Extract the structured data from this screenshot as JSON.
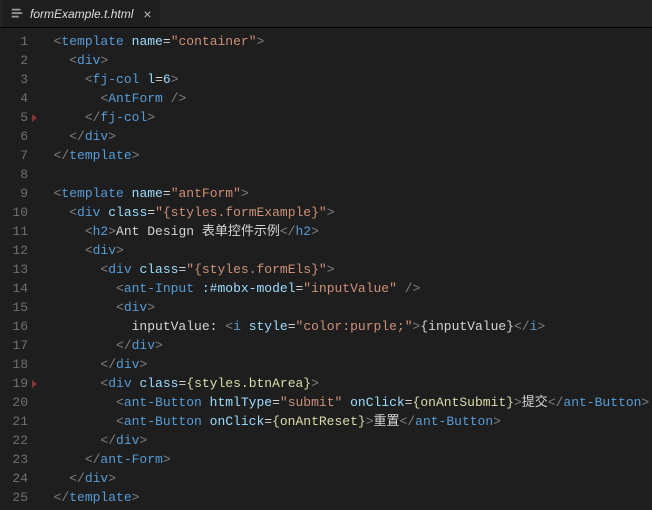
{
  "tab": {
    "filename": "formExample.t.html",
    "close_glyph": "×"
  },
  "lineNumbers": [
    "1",
    "2",
    "3",
    "4",
    "5",
    "6",
    "7",
    "8",
    "9",
    "10",
    "11",
    "12",
    "13",
    "14",
    "15",
    "16",
    "17",
    "18",
    "19",
    "20",
    "21",
    "22",
    "23",
    "24",
    "25"
  ],
  "code": {
    "rows": [
      {
        "indent": 1,
        "tokens": [
          {
            "c": "t-punc",
            "t": "<"
          },
          {
            "c": "t-tag",
            "t": "template"
          },
          {
            "c": "t-text",
            "t": " "
          },
          {
            "c": "t-attr",
            "t": "name"
          },
          {
            "c": "t-text",
            "t": "="
          },
          {
            "c": "t-str",
            "t": "\"container\""
          },
          {
            "c": "t-punc",
            "t": ">"
          }
        ]
      },
      {
        "indent": 2,
        "tokens": [
          {
            "c": "t-punc",
            "t": "<"
          },
          {
            "c": "t-tag",
            "t": "div"
          },
          {
            "c": "t-punc",
            "t": ">"
          }
        ]
      },
      {
        "indent": 3,
        "tokens": [
          {
            "c": "t-punc",
            "t": "<"
          },
          {
            "c": "t-tag",
            "t": "fj-col"
          },
          {
            "c": "t-text",
            "t": " "
          },
          {
            "c": "t-attr",
            "t": "l"
          },
          {
            "c": "t-text",
            "t": "="
          },
          {
            "c": "t-attr",
            "t": "6"
          },
          {
            "c": "t-punc",
            "t": ">"
          }
        ]
      },
      {
        "indent": 4,
        "tokens": [
          {
            "c": "t-punc",
            "t": "<"
          },
          {
            "c": "t-tag",
            "t": "AntForm"
          },
          {
            "c": "t-text",
            "t": " "
          },
          {
            "c": "t-punc",
            "t": "/>"
          }
        ]
      },
      {
        "indent": 3,
        "tokens": [
          {
            "c": "t-punc",
            "t": "</"
          },
          {
            "c": "t-tag",
            "t": "fj-col"
          },
          {
            "c": "t-punc",
            "t": ">"
          }
        ]
      },
      {
        "indent": 2,
        "tokens": [
          {
            "c": "t-punc",
            "t": "</"
          },
          {
            "c": "t-tag",
            "t": "div"
          },
          {
            "c": "t-punc",
            "t": ">"
          }
        ]
      },
      {
        "indent": 1,
        "tokens": [
          {
            "c": "t-punc",
            "t": "</"
          },
          {
            "c": "t-tag",
            "t": "template"
          },
          {
            "c": "t-punc",
            "t": ">"
          }
        ]
      },
      {
        "indent": 0,
        "tokens": []
      },
      {
        "indent": 1,
        "tokens": [
          {
            "c": "t-punc",
            "t": "<"
          },
          {
            "c": "t-tag",
            "t": "template"
          },
          {
            "c": "t-text",
            "t": " "
          },
          {
            "c": "t-attr",
            "t": "name"
          },
          {
            "c": "t-text",
            "t": "="
          },
          {
            "c": "t-str",
            "t": "\"antForm\""
          },
          {
            "c": "t-punc",
            "t": ">"
          }
        ]
      },
      {
        "indent": 2,
        "tokens": [
          {
            "c": "t-punc",
            "t": "<"
          },
          {
            "c": "t-tag",
            "t": "div"
          },
          {
            "c": "t-text",
            "t": " "
          },
          {
            "c": "t-attr",
            "t": "class"
          },
          {
            "c": "t-text",
            "t": "="
          },
          {
            "c": "t-str",
            "t": "\"{styles.formExample}\""
          },
          {
            "c": "t-punc",
            "t": ">"
          }
        ]
      },
      {
        "indent": 3,
        "tokens": [
          {
            "c": "t-punc",
            "t": "<"
          },
          {
            "c": "t-tag",
            "t": "h2"
          },
          {
            "c": "t-punc",
            "t": ">"
          },
          {
            "c": "t-text",
            "t": "Ant Design 表单控件示例"
          },
          {
            "c": "t-punc",
            "t": "</"
          },
          {
            "c": "t-tag",
            "t": "h2"
          },
          {
            "c": "t-punc",
            "t": ">"
          }
        ]
      },
      {
        "indent": 3,
        "tokens": [
          {
            "c": "t-punc",
            "t": "<"
          },
          {
            "c": "t-tag",
            "t": "div"
          },
          {
            "c": "t-punc",
            "t": ">"
          }
        ]
      },
      {
        "indent": 4,
        "tokens": [
          {
            "c": "t-punc",
            "t": "<"
          },
          {
            "c": "t-tag",
            "t": "div"
          },
          {
            "c": "t-text",
            "t": " "
          },
          {
            "c": "t-attr",
            "t": "class"
          },
          {
            "c": "t-text",
            "t": "="
          },
          {
            "c": "t-str",
            "t": "\"{styles.formEls}\""
          },
          {
            "c": "t-punc",
            "t": ">"
          }
        ]
      },
      {
        "indent": 5,
        "tokens": [
          {
            "c": "t-punc",
            "t": "<"
          },
          {
            "c": "t-tag",
            "t": "ant-Input"
          },
          {
            "c": "t-text",
            "t": " "
          },
          {
            "c": "t-attr",
            "t": ":#mobx-model"
          },
          {
            "c": "t-text",
            "t": "="
          },
          {
            "c": "t-str",
            "t": "\"inputValue\""
          },
          {
            "c": "t-text",
            "t": " "
          },
          {
            "c": "t-punc",
            "t": "/>"
          }
        ]
      },
      {
        "indent": 5,
        "tokens": [
          {
            "c": "t-punc",
            "t": "<"
          },
          {
            "c": "t-tag",
            "t": "div"
          },
          {
            "c": "t-punc",
            "t": ">"
          }
        ]
      },
      {
        "indent": 6,
        "tokens": [
          {
            "c": "t-text",
            "t": "inputValue: "
          },
          {
            "c": "t-punc",
            "t": "<"
          },
          {
            "c": "t-tag",
            "t": "i"
          },
          {
            "c": "t-text",
            "t": " "
          },
          {
            "c": "t-attr",
            "t": "style"
          },
          {
            "c": "t-text",
            "t": "="
          },
          {
            "c": "t-str",
            "t": "\"color:purple;\""
          },
          {
            "c": "t-punc",
            "t": ">"
          },
          {
            "c": "t-text",
            "t": "{inputValue}"
          },
          {
            "c": "t-punc",
            "t": "</"
          },
          {
            "c": "t-tag",
            "t": "i"
          },
          {
            "c": "t-punc",
            "t": ">"
          }
        ]
      },
      {
        "indent": 5,
        "tokens": [
          {
            "c": "t-punc",
            "t": "</"
          },
          {
            "c": "t-tag",
            "t": "div"
          },
          {
            "c": "t-punc",
            "t": ">"
          }
        ]
      },
      {
        "indent": 4,
        "tokens": [
          {
            "c": "t-punc",
            "t": "</"
          },
          {
            "c": "t-tag",
            "t": "div"
          },
          {
            "c": "t-punc",
            "t": ">"
          }
        ]
      },
      {
        "indent": 4,
        "tokens": [
          {
            "c": "t-punc",
            "t": "<"
          },
          {
            "c": "t-tag",
            "t": "div"
          },
          {
            "c": "t-text",
            "t": " "
          },
          {
            "c": "t-attr",
            "t": "class"
          },
          {
            "c": "t-text",
            "t": "="
          },
          {
            "c": "t-js",
            "t": "{styles.btnArea}"
          },
          {
            "c": "t-punc",
            "t": ">"
          }
        ]
      },
      {
        "indent": 5,
        "tokens": [
          {
            "c": "t-punc",
            "t": "<"
          },
          {
            "c": "t-tag",
            "t": "ant-Button"
          },
          {
            "c": "t-text",
            "t": " "
          },
          {
            "c": "t-attr",
            "t": "htmlType"
          },
          {
            "c": "t-text",
            "t": "="
          },
          {
            "c": "t-str",
            "t": "\"submit\""
          },
          {
            "c": "t-text",
            "t": " "
          },
          {
            "c": "t-attr",
            "t": "onClick"
          },
          {
            "c": "t-text",
            "t": "="
          },
          {
            "c": "t-js",
            "t": "{onAntSubmit}"
          },
          {
            "c": "t-punc",
            "t": ">"
          },
          {
            "c": "t-text",
            "t": "提交"
          },
          {
            "c": "t-punc",
            "t": "</"
          },
          {
            "c": "t-tag",
            "t": "ant-Button"
          },
          {
            "c": "t-punc",
            "t": ">"
          }
        ]
      },
      {
        "indent": 5,
        "tokens": [
          {
            "c": "t-punc",
            "t": "<"
          },
          {
            "c": "t-tag",
            "t": "ant-Button"
          },
          {
            "c": "t-text",
            "t": " "
          },
          {
            "c": "t-attr",
            "t": "onClick"
          },
          {
            "c": "t-text",
            "t": "="
          },
          {
            "c": "t-js",
            "t": "{onAntReset}"
          },
          {
            "c": "t-punc",
            "t": ">"
          },
          {
            "c": "t-text",
            "t": "重置"
          },
          {
            "c": "t-punc",
            "t": "</"
          },
          {
            "c": "t-tag",
            "t": "ant-Button"
          },
          {
            "c": "t-punc",
            "t": ">"
          }
        ]
      },
      {
        "indent": 4,
        "tokens": [
          {
            "c": "t-punc",
            "t": "</"
          },
          {
            "c": "t-tag",
            "t": "div"
          },
          {
            "c": "t-punc",
            "t": ">"
          }
        ]
      },
      {
        "indent": 3,
        "tokens": [
          {
            "c": "t-punc",
            "t": "</"
          },
          {
            "c": "t-tag",
            "t": "ant-Form"
          },
          {
            "c": "t-punc",
            "t": ">"
          }
        ]
      },
      {
        "indent": 2,
        "tokens": [
          {
            "c": "t-punc",
            "t": "</"
          },
          {
            "c": "t-tag",
            "t": "div"
          },
          {
            "c": "t-punc",
            "t": ">"
          }
        ]
      },
      {
        "indent": 1,
        "tokens": [
          {
            "c": "t-punc",
            "t": "</"
          },
          {
            "c": "t-tag",
            "t": "template"
          },
          {
            "c": "t-punc",
            "t": ">"
          }
        ]
      }
    ]
  },
  "foldMarkers": [
    5,
    19
  ]
}
